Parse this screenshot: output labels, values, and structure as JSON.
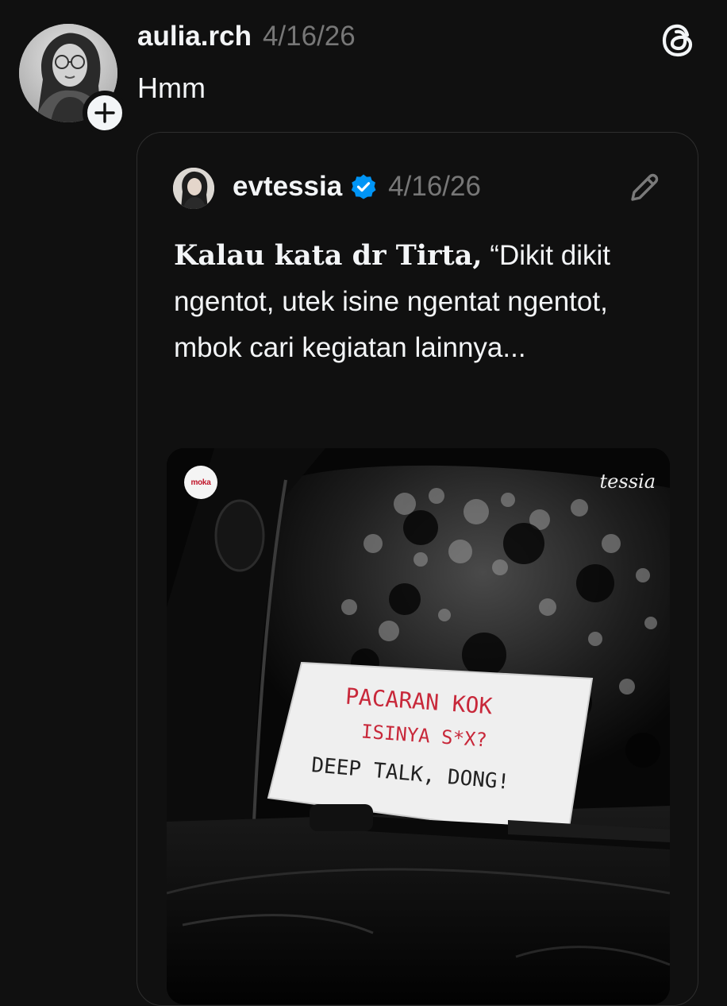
{
  "post": {
    "username": "aulia.rch",
    "timestamp": "4/16/26",
    "text": "Hmm",
    "follow_symbol": "+",
    "icons": {
      "logo": "threads-logo-icon",
      "follow": "plus-icon"
    }
  },
  "quoted_post": {
    "username": "evtessia",
    "verified": true,
    "timestamp": "4/16/26",
    "text_lead": "Kalau kata dr Tirta,",
    "text_rest": " “Dikit dikit ngentot, utek isine ngentat ngentot, mbok cari kegiatan lainnya...",
    "icons": {
      "verified": "verified-badge-icon",
      "edit": "pencil-edit-icon"
    },
    "image": {
      "badge_text": "moka",
      "watermark": "tessia",
      "sign_lines": [
        "PACARAN KOK",
        "ISINYA S*X?",
        "DEEP TALK, DONG!"
      ]
    }
  },
  "colors": {
    "background": "#101010",
    "text_primary": "#f3f5f7",
    "text_secondary": "#777777",
    "border": "#2e2e2e",
    "verified": "#0095f6",
    "sign_red": "#c8283a"
  }
}
